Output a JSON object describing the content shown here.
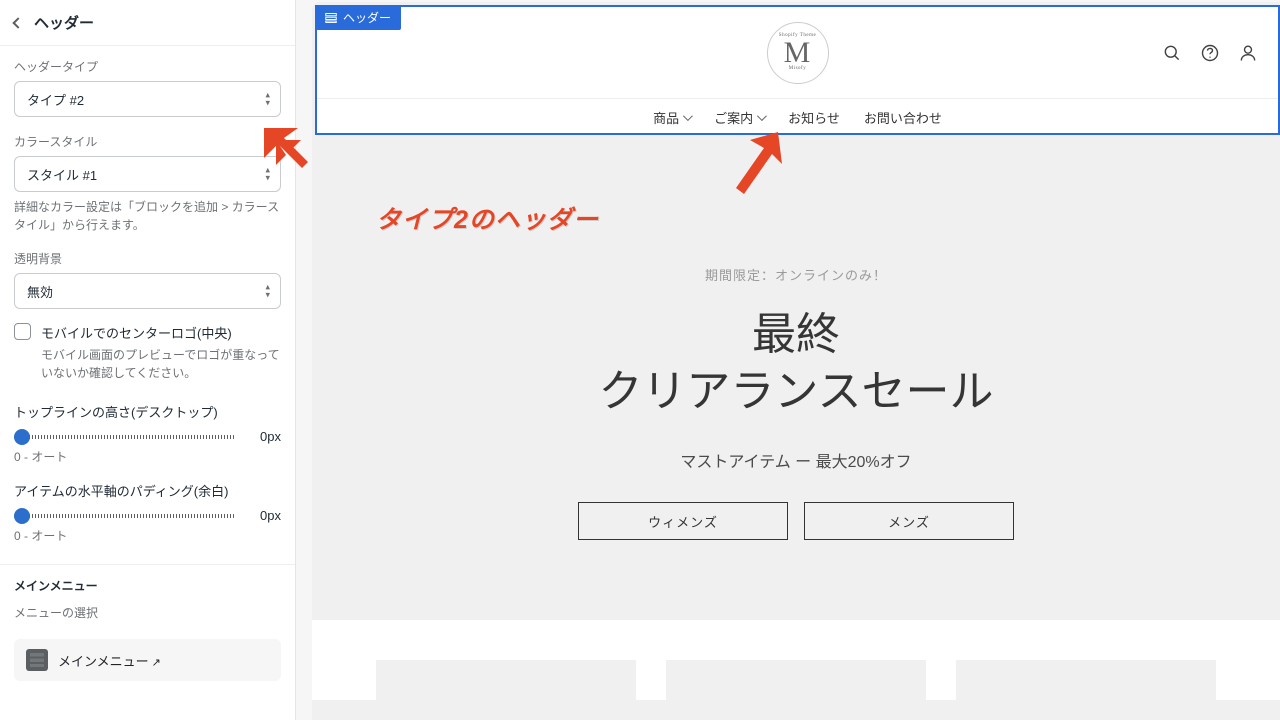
{
  "sidebar": {
    "title": "ヘッダー",
    "header_type_label": "ヘッダータイプ",
    "header_type_value": "タイプ #2",
    "color_style_label": "カラースタイル",
    "color_style_value": "スタイル #1",
    "color_helper": "詳細なカラー設定は「ブロックを追加 > カラースタイル」から行えます。",
    "transparent_label": "透明背景",
    "transparent_value": "無効",
    "center_logo_label": "モバイルでのセンターロゴ(中央)",
    "center_logo_helper": "モバイル画面のプレビューでロゴが重なっていないか確認してください。",
    "topline_label": "トップラインの高さ(デスクトップ)",
    "topline_value": "0px",
    "topline_range": "0 - オート",
    "padding_label": "アイテムの水平軸のパディング(余白)",
    "padding_value": "0px",
    "padding_range": "0 - オート",
    "main_menu_heading": "メインメニュー",
    "menu_select_label": "メニューの選択",
    "menu_select_value": "メインメニュー"
  },
  "selection_badge": "ヘッダー",
  "nav": {
    "products": "商品",
    "guide": "ご案内",
    "news": "お知らせ",
    "contact": "お問い合わせ"
  },
  "hero": {
    "tag": "期間限定：オンラインのみ！",
    "line1": "最終",
    "line2": "クリアランスセール",
    "sub": "マストアイテム ー 最大20%オフ",
    "btn_women": "ウィメンズ",
    "btn_men": "メンズ"
  },
  "annotation": "タイプ2のヘッダー"
}
